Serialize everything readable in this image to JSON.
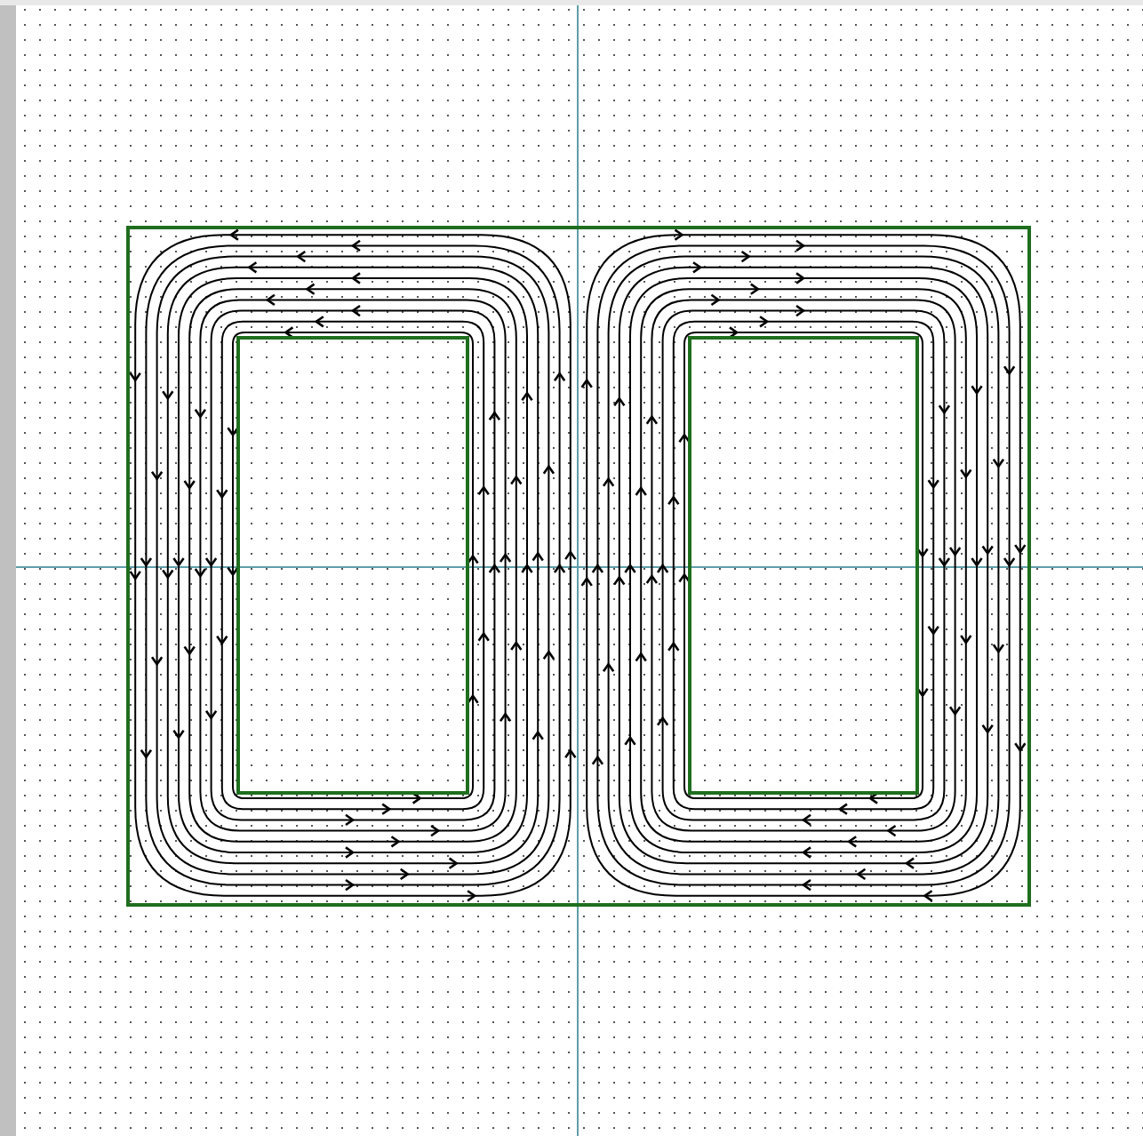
{
  "plot": {
    "grid": true,
    "axes": true
  }
}
